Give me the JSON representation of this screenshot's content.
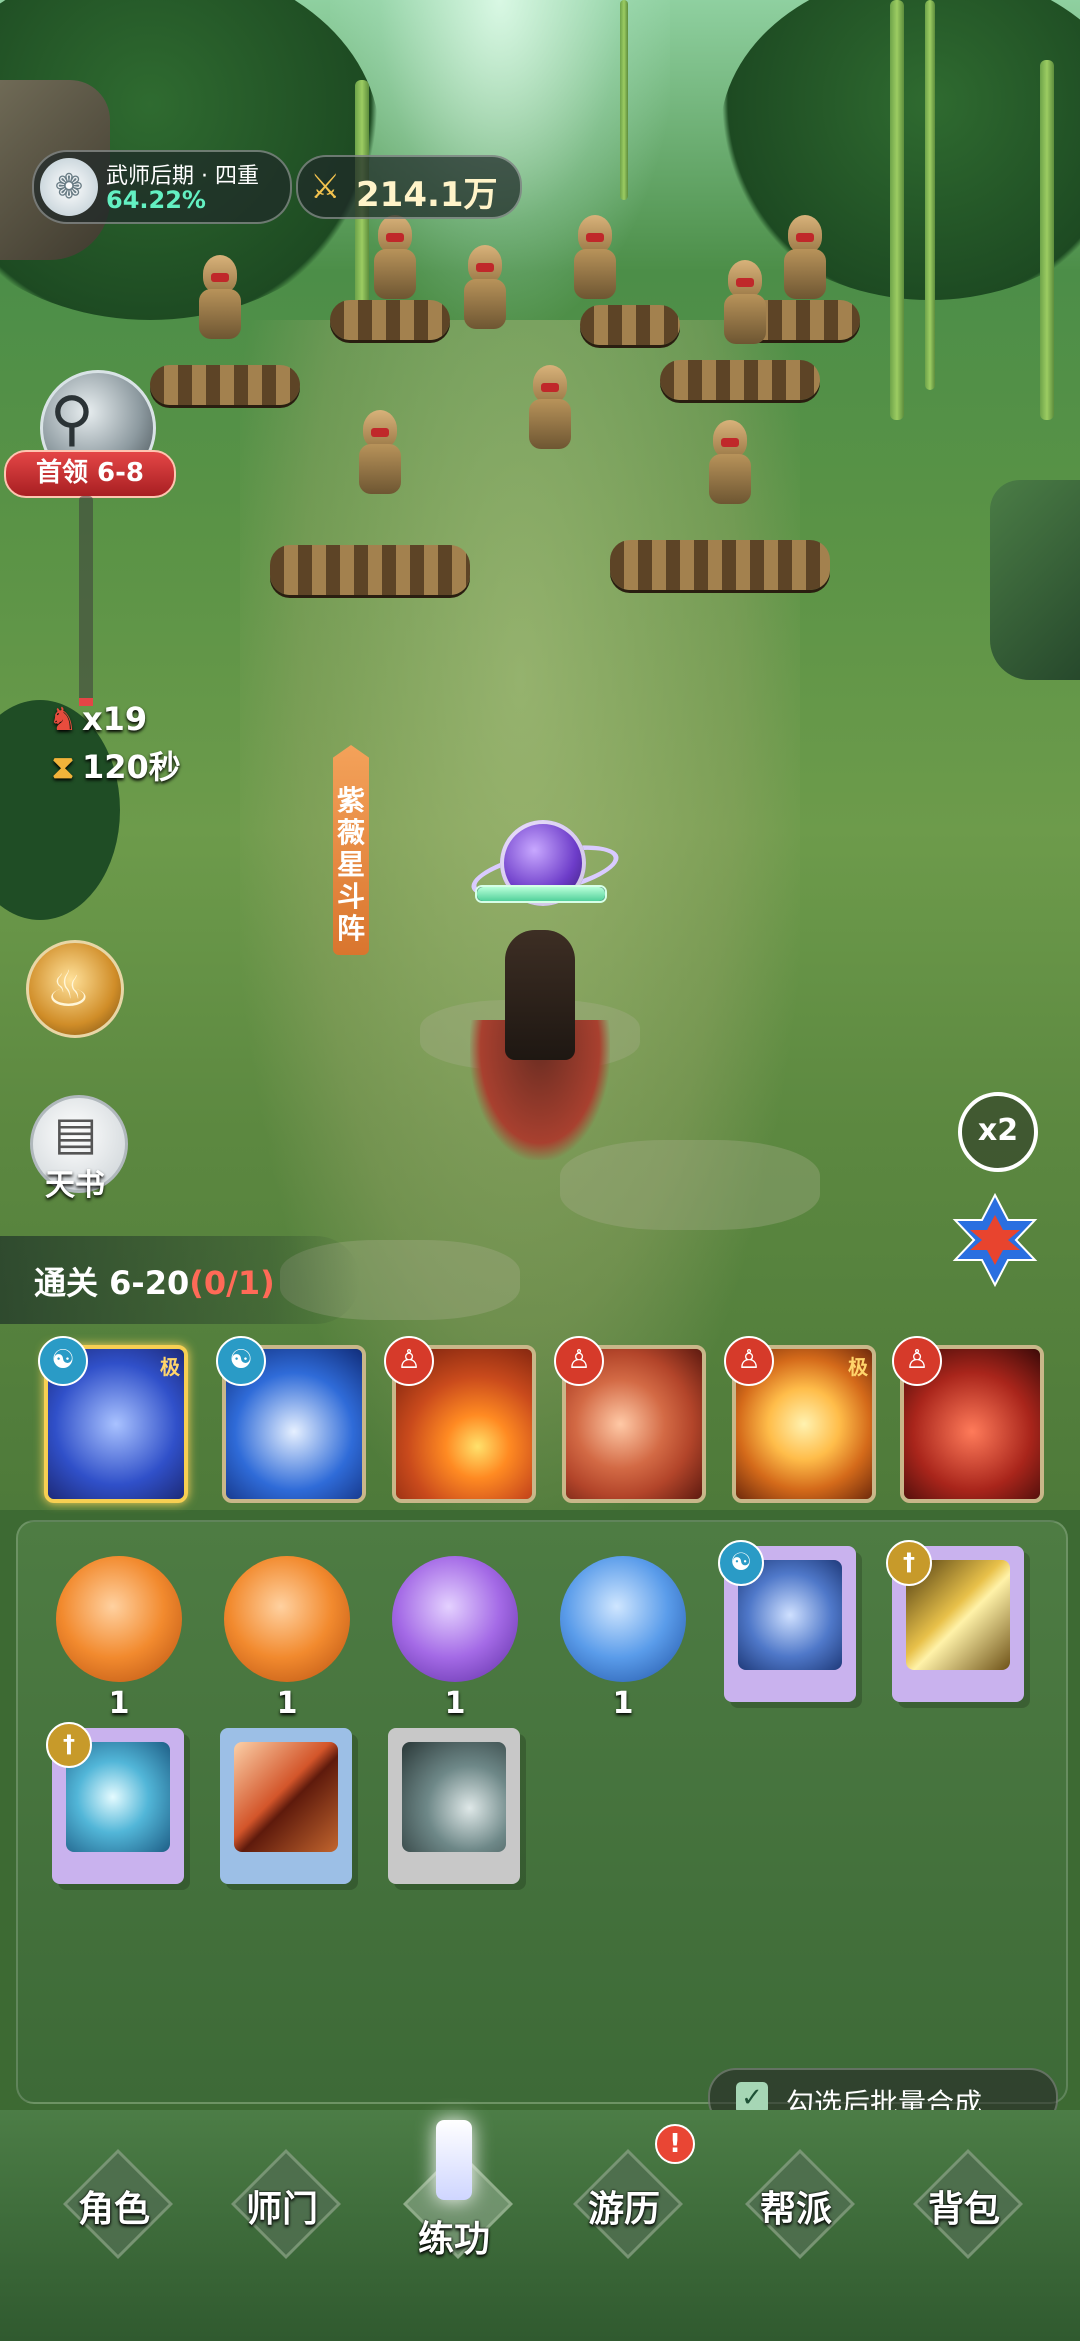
{
  "hud": {
    "rank_title": "武师后期 · 四重",
    "rank_progress": "64.22%",
    "power": "214.1万",
    "boss_label": "首领 6-8",
    "enemy_count": "x19",
    "timer": "120秒",
    "formation": [
      "紫",
      "薇",
      "星",
      "斗",
      "阵"
    ],
    "tianshu_label": "天书",
    "speed": "x2",
    "stage_text": "通关 6-20",
    "stage_progress": "(0/1)"
  },
  "skills": [
    {
      "tag": "极",
      "element": "water",
      "color": "#3050c9"
    },
    {
      "tag": "",
      "element": "water",
      "color": "#2f6bd8"
    },
    {
      "tag": "",
      "element": "fire",
      "color": "#c94a1c"
    },
    {
      "tag": "",
      "element": "fire",
      "color": "#b3452a"
    },
    {
      "tag": "极",
      "element": "fire",
      "color": "#d46a1a"
    },
    {
      "tag": "",
      "element": "fire",
      "color": "#a9251b"
    }
  ],
  "inventory": {
    "orbs": [
      {
        "count": "1",
        "color": "orange"
      },
      {
        "count": "1",
        "color": "orange"
      },
      {
        "count": "1",
        "color": "purple"
      },
      {
        "count": "1",
        "color": "blue"
      }
    ],
    "batch_label": "勾选后批量合成"
  },
  "nav": [
    {
      "label": "角色"
    },
    {
      "label": "师门"
    },
    {
      "label": "练功"
    },
    {
      "label": "游历"
    },
    {
      "label": "帮派"
    },
    {
      "label": "背包"
    }
  ],
  "nav_notice": "!"
}
